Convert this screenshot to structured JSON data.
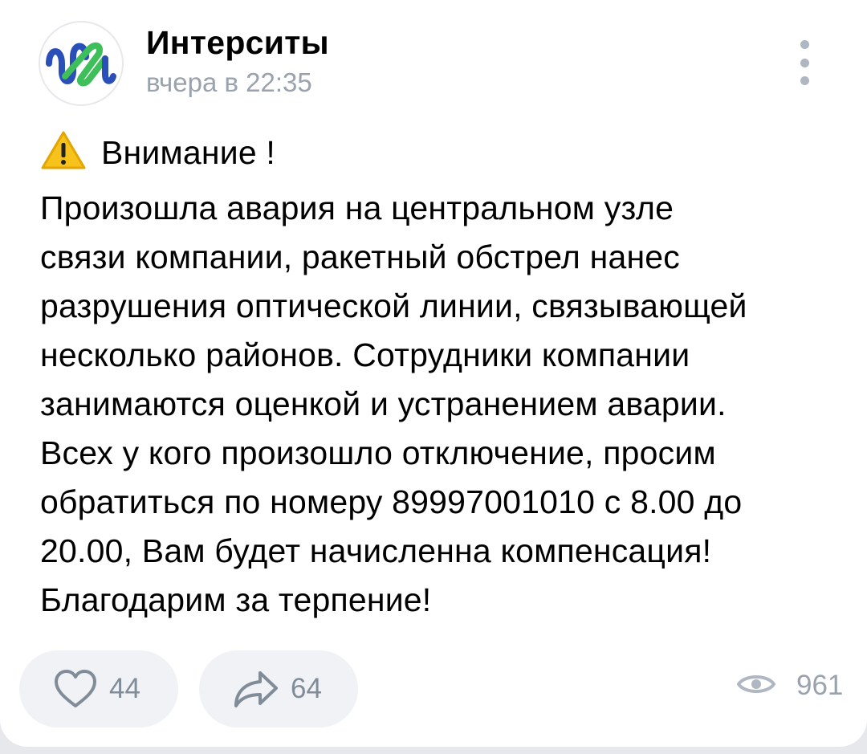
{
  "post": {
    "author": "Интерситы",
    "time": "вчера в 22:35",
    "text_lines": [
      "Внимание !",
      "Произошла авария на центральном узле",
      "связи компании, ракетный обстрел нанес",
      "разрушения оптической линии, связывающей",
      "несколько районов. Сотрудники компании",
      "занимаются оценкой и устранением аварии.",
      "Всех у кого произошло отключение, просим",
      "обратиться по номеру 89997001010 с 8.00 до",
      "20.00, Вам будет начисленна компенсация!",
      "Благодарим за терпение!"
    ]
  },
  "actions": {
    "likes": "44",
    "shares": "64",
    "views": "961"
  },
  "icons": {
    "avatar": "intercity-logo-icon",
    "more": "more-vertical-icon",
    "warning": "warning-icon",
    "like": "heart-icon",
    "share": "share-arrow-icon",
    "views": "eye-icon"
  },
  "colors": {
    "background": "#e7e8ec",
    "card": "#ffffff",
    "secondary_text": "#99a2ad",
    "pill": "#f0f2f5",
    "logo_blue": "#2a4fb8",
    "logo_green": "#3fbf5a"
  }
}
